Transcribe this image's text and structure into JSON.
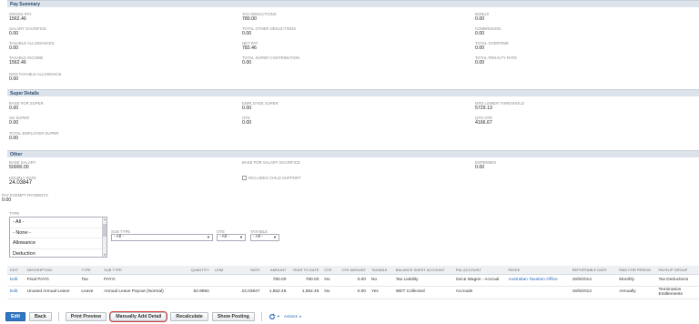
{
  "pay_summary": {
    "header": "Pay Summary",
    "gross_pay": {
      "label": "GROSS PAY",
      "value": "1562.46"
    },
    "tax_deductions": {
      "label": "TAX DEDUCTIONS",
      "value": "780.00"
    },
    "bonus": {
      "label": "BONUS",
      "value": "0.00"
    },
    "salary_sacrifice": {
      "label": "SALARY SACRIFICE",
      "value": "0.00"
    },
    "total_other_deductions": {
      "label": "TOTAL OTHER DEDUCTIONS",
      "value": "0.00"
    },
    "commission": {
      "label": "COMMISSION",
      "value": "0.00"
    },
    "taxable_allowances": {
      "label": "TAXABLE ALLOWANCES",
      "value": "0.00"
    },
    "net_pay": {
      "label": "NET PAY",
      "value": "782.46"
    },
    "total_overtime": {
      "label": "TOTAL OVERTIME",
      "value": "0.00"
    },
    "taxable_income": {
      "label": "TAXABLE INCOME",
      "value": "1562.46"
    },
    "total_super_contribution": {
      "label": "TOTAL SUPER CONTRIBUTION",
      "value": "0.00"
    },
    "total_penalty_rate": {
      "label": "TOTAL PENALTY RATE",
      "value": "0.00"
    },
    "non_taxable_allowance": {
      "label": "NON TAXABLE ALLOWANCE",
      "value": "0.00"
    }
  },
  "super_details": {
    "header": "Super Details",
    "base_for_super": {
      "label": "BASE FOR SUPER",
      "value": "0.00"
    },
    "employee_super": {
      "label": "EMPLOYEE SUPER",
      "value": "0.00"
    },
    "mtd_lower_threshold": {
      "label": "MTD LOWER THRESHOLD",
      "value": "5729.13"
    },
    "sg_super": {
      "label": "SG SUPER",
      "value": "0.00"
    },
    "ote": {
      "label": "OTE",
      "value": "0.00"
    },
    "qtd_ote": {
      "label": "QTD OTE",
      "value": "4166.67"
    },
    "total_employer_super": {
      "label": "TOTAL EMPLOYER SUPER",
      "value": "0.00"
    }
  },
  "other": {
    "header": "Other",
    "base_salary": {
      "label": "BASE SALARY",
      "value": "50000.00"
    },
    "base_for_salary_sacrifice": {
      "label": "BASE FOR SALARY SACRIFICE",
      "value": ""
    },
    "expenses": {
      "label": "EXPENSES",
      "value": "0.00"
    },
    "hourly_rate": {
      "label": "HOURLY RATE",
      "value": "24.03847"
    },
    "includes_child_support": {
      "label": "INCLUDES CHILD SUPPORT"
    },
    "pay_exempt_payments": {
      "label": "PAY EXEMPT PAYMENTS",
      "value": "0.00"
    }
  },
  "filters": {
    "type_label": "TYPE",
    "type_options": [
      "- All -",
      "- None -",
      "Allowance",
      "Deduction"
    ],
    "sub_type_label": "SUB TYPE",
    "sub_type_value": "- All -",
    "ote_label": "OTE",
    "ote_value": "- All -",
    "taxable_label": "TAXABLE",
    "taxable_value": "- All -"
  },
  "grid": {
    "columns": [
      "EDIT",
      "DESCRIPTION",
      "TYPE",
      "SUB TYPE",
      "QUANTITY",
      "UOM",
      "RATE",
      "AMOUNT",
      "YEAR TO DATE",
      "OTE",
      "OTE AMOUNT",
      "TAXABLE",
      "BALANCE SHEET ACCOUNT",
      "P&L ACCOUNT",
      "PAYEE",
      "REPORTABLE DATE",
      "PAID FOR PERIOD",
      "PAYSLIP GROUP"
    ],
    "rows": [
      {
        "edit": "Edit",
        "description": "Final PAYG",
        "type": "Tax",
        "sub_type": "PAYG",
        "quantity": "",
        "uom": "",
        "rate": "",
        "amount": "780.00",
        "ytd": "780.00",
        "ote": "No",
        "ote_amount": "0.00",
        "taxable": "No",
        "balance_sheet": "Tax Liability",
        "pl_account": "Sal & Wages - Accrual",
        "payee": "Australian Taxation Office",
        "reportable_date": "16/9/2014",
        "paid_for_period": "Monthly",
        "payslip_group": "Tax Deductions"
      },
      {
        "edit": "Edit",
        "description": "Unused Annual Leave",
        "type": "Leave",
        "sub_type": "Annual Leave Payout (Normal)",
        "quantity": "64.9984",
        "uom": "",
        "rate": "24.03847",
        "amount": "1,562.46",
        "ytd": "1,562.46",
        "ote": "No",
        "ote_amount": "0.00",
        "taxable": "Yes",
        "balance_sheet": "WET Collected",
        "pl_account": "Accruals",
        "payee": "",
        "reportable_date": "16/9/2014",
        "paid_for_period": "Annually",
        "payslip_group": "Termination Entitlements"
      }
    ]
  },
  "toolbar": {
    "edit": "Edit",
    "back": "Back",
    "print_preview": "Print Preview",
    "manually_add_detail": "Manually Add Detail",
    "recalculate": "Recalculate",
    "show_posting": "Show Posting",
    "actions": "Actions"
  },
  "icons": {
    "actions_icon": "refresh-icon",
    "caret": "chevron-down-icon"
  },
  "colors": {
    "primary": "#2f77c5",
    "link": "#2a6ab5",
    "section_header_bg": "#dde3ea",
    "highlight": "#d63a3a"
  }
}
